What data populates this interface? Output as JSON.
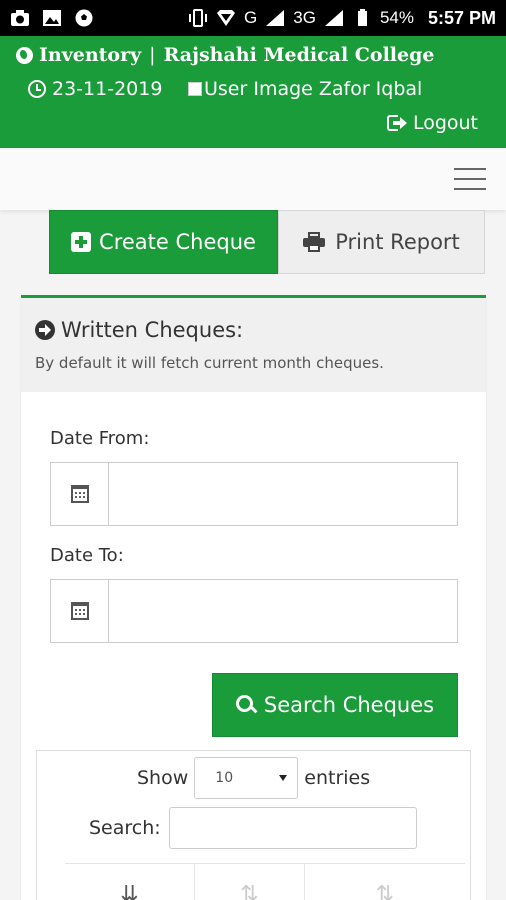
{
  "status_bar": {
    "icons_left": [
      "camera-icon",
      "image-icon",
      "soccer-ball-icon"
    ],
    "icons_right": [
      "vibrate-icon",
      "wifi-icon",
      "signal-icon",
      "battery-icon"
    ],
    "network_g": "G",
    "network_3g": "3G",
    "battery": "54%",
    "time": "5:57 PM"
  },
  "header": {
    "app_name": "Inventory",
    "separator": "|",
    "org_name": "Rajshahi Medical College",
    "date": "23-11-2019",
    "user_image_alt": "User Image",
    "user_name": "Zafor Iqbal",
    "logout_label": "Logout",
    "accent_color": "#1a9c3a"
  },
  "actions": {
    "create_label": "Create Cheque",
    "print_label": "Print Report"
  },
  "panel": {
    "title": "Written Cheques:",
    "subtitle": "By default it will fetch current month cheques.",
    "date_from_label": "Date From:",
    "date_from_value": "",
    "date_to_label": "Date To:",
    "date_to_value": "",
    "search_button_label": "Search Cheques"
  },
  "table": {
    "show_label": "Show",
    "entries_selected": "10",
    "entries_label": "entries",
    "search_label": "Search:",
    "search_value": "",
    "sort_columns": [
      {
        "icon": "sort-amount-icon",
        "active": true
      },
      {
        "icon": "sort-both-icon",
        "active": false
      },
      {
        "icon": "sort-both-icon",
        "active": false
      }
    ]
  }
}
